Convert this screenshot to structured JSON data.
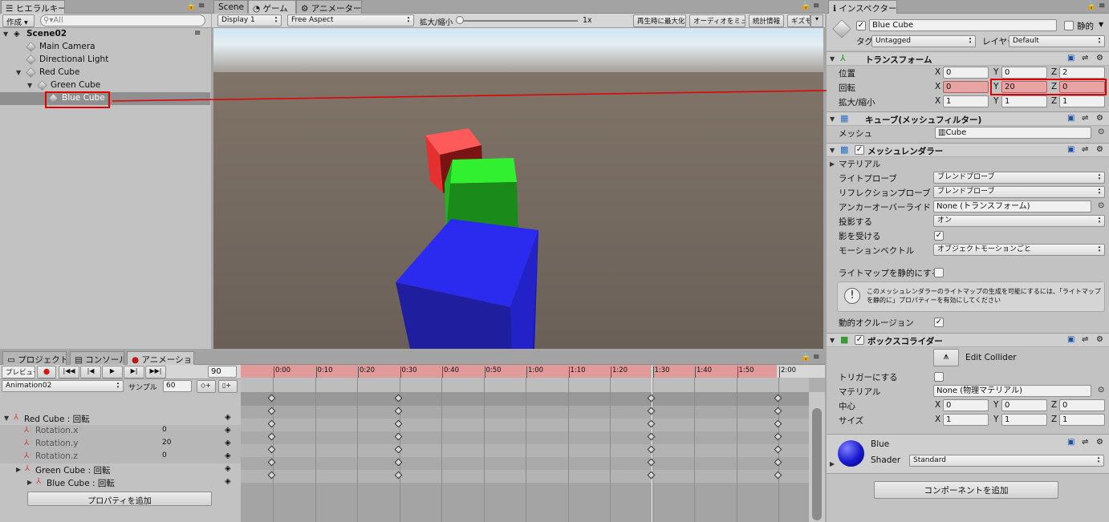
{
  "hierarchy": {
    "tab": "ヒエラルキー",
    "create": "作成",
    "search_placeholder": "All",
    "scene": "Scene02",
    "items": [
      "Main Camera",
      "Directional Light",
      "Red Cube",
      "Green Cube",
      "Blue Cube"
    ]
  },
  "center_tabs": [
    "Scene",
    "ゲーム",
    "アニメーター"
  ],
  "game_toolbar": {
    "display": "Display 1",
    "aspect": "Free Aspect",
    "scale_label": "拡大/縮小",
    "scale_value": "1x",
    "maximize": "再生時に最大化",
    "mute": "オーディオをミュート",
    "stats": "統計情報",
    "gizmos": "ギズモ"
  },
  "bottom_tabs": [
    "プロジェクト",
    "コンソール",
    "アニメーション"
  ],
  "animation": {
    "preview": "プレビュー",
    "frame": "90",
    "clip": "Animation02",
    "samples_label": "サンプル",
    "samples": "60",
    "ticks": [
      "0:00",
      "0:10",
      "0:20",
      "0:30",
      "0:40",
      "0:50",
      "1:00",
      "1:10",
      "1:20",
      "1:30",
      "1:40",
      "1:50",
      "2:00"
    ],
    "properties": [
      {
        "label": "Red Cube : 回転",
        "value": ""
      },
      {
        "label": "Rotation.x",
        "value": "0"
      },
      {
        "label": "Rotation.y",
        "value": "20"
      },
      {
        "label": "Rotation.z",
        "value": "0"
      },
      {
        "label": "Green Cube : 回転",
        "value": ""
      },
      {
        "label": "Blue Cube : 回転",
        "value": ""
      }
    ],
    "add_property": "プロパティを追加"
  },
  "inspector": {
    "tab": "インスペクター",
    "object_name": "Blue Cube",
    "static_label": "静的",
    "tag_label": "タグ",
    "tag": "Untagged",
    "layer_label": "レイヤー",
    "layer": "Default",
    "transform": {
      "title": "トランスフォーム",
      "position_label": "位置",
      "position": [
        "0",
        "0",
        "2"
      ],
      "rotation_label": "回転",
      "rotation": [
        "0",
        "20",
        "0"
      ],
      "scale_label": "拡大/縮小",
      "scale": [
        "1",
        "1",
        "1"
      ]
    },
    "mesh_filter": {
      "title": "キューブ(メッシュフィルター)",
      "mesh_label": "メッシュ",
      "mesh": "Cube"
    },
    "mesh_renderer": {
      "title": "メッシュレンダラー",
      "materials": "マテリアル",
      "light_probes_label": "ライトプローブ",
      "light_probes": "ブレンドプローブ",
      "reflection_label": "リフレクションプローブ",
      "reflection": "ブレンドプローブ",
      "anchor_label": "アンカーオーバーライド",
      "anchor": "None (トランスフォーム)",
      "cast_label": "投影する",
      "cast": "オン",
      "receive_label": "影を受ける",
      "motion_label": "モーションベクトル",
      "motion": "オブジェクトモーションごと",
      "lightmap_label": "ライトマップを静的にする",
      "info": "このメッシュレンダラーのライトマップの生成を可能にするには、「ライトマップを静的に」プロパティーを有効にしてください",
      "occlusion_label": "動的オクルージョン"
    },
    "box_collider": {
      "title": "ボックスコライダー",
      "edit": "Edit Collider",
      "trigger_label": "トリガーにする",
      "material_label": "マテリアル",
      "material": "None (物理マテリアル)",
      "center_label": "中心",
      "center": [
        "0",
        "0",
        "0"
      ],
      "size_label": "サイズ",
      "size": [
        "1",
        "1",
        "1"
      ]
    },
    "material": {
      "name": "Blue",
      "shader_label": "Shader",
      "shader": "Standard"
    },
    "add_component": "コンポーネントを追加"
  },
  "colors": {
    "red": "#e53030",
    "green": "#1fd11f",
    "blue": "#2b2bf0",
    "highlight": "#e00000"
  }
}
